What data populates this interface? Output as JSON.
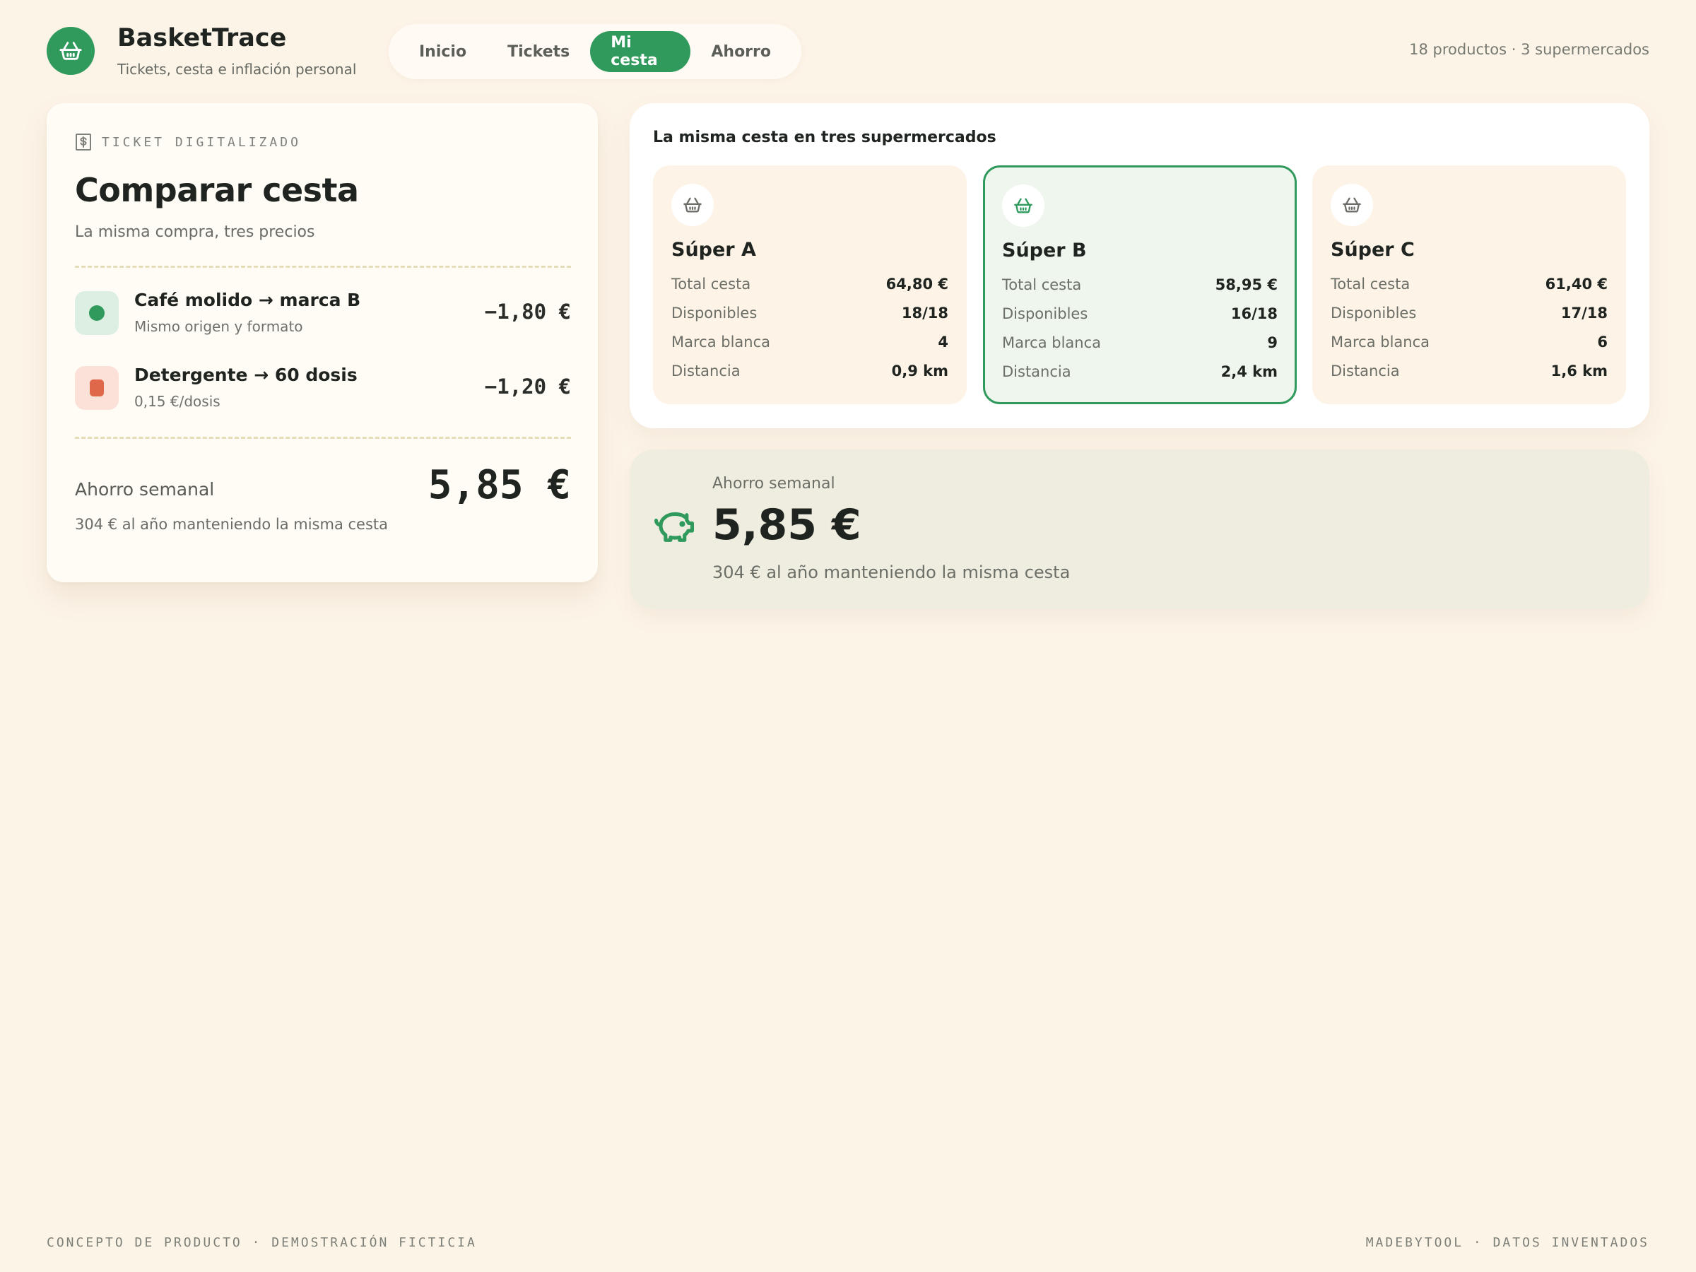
{
  "app": {
    "name": "BasketTrace",
    "tagline": "Tickets, cesta e inflación personal",
    "meta": "18 productos · 3 supermercados"
  },
  "nav": {
    "items": [
      {
        "label": "Inicio",
        "active": false
      },
      {
        "label": "Tickets",
        "active": false
      },
      {
        "label": "Mi cesta",
        "active": true
      },
      {
        "label": "Ahorro",
        "active": false
      }
    ]
  },
  "ticket": {
    "kicker": "TICKET DIGITALIZADO",
    "title": "Comparar cesta",
    "subtitle": "La misma compra, tres precios",
    "swaps": [
      {
        "name": "Café molido → marca B",
        "note": "Mismo origen y formato",
        "amount": "−1,80 €",
        "color": "green"
      },
      {
        "name": "Detergente → 60 dosis",
        "note": "0,15 €/dosis",
        "amount": "−1,20 €",
        "color": "red"
      }
    ],
    "saving_label": "Ahorro semanal",
    "saving_value": "5,85 €",
    "yearly": "304 € al año manteniendo la misma cesta"
  },
  "compare": {
    "title": "La misma cesta en tres supermercados",
    "stores": [
      {
        "name": "Súper A",
        "best": false,
        "rows": [
          {
            "label": "Total cesta",
            "value": "64,80 €"
          },
          {
            "label": "Disponibles",
            "value": "18/18"
          },
          {
            "label": "Marca blanca",
            "value": "4"
          },
          {
            "label": "Distancia",
            "value": "0,9 km"
          }
        ]
      },
      {
        "name": "Súper B",
        "best": true,
        "rows": [
          {
            "label": "Total cesta",
            "value": "58,95 €"
          },
          {
            "label": "Disponibles",
            "value": "16/18"
          },
          {
            "label": "Marca blanca",
            "value": "9"
          },
          {
            "label": "Distancia",
            "value": "2,4 km"
          }
        ]
      },
      {
        "name": "Súper C",
        "best": false,
        "rows": [
          {
            "label": "Total cesta",
            "value": "61,40 €"
          },
          {
            "label": "Disponibles",
            "value": "17/18"
          },
          {
            "label": "Marca blanca",
            "value": "6"
          },
          {
            "label": "Distancia",
            "value": "1,6 km"
          }
        ]
      }
    ]
  },
  "saving": {
    "label": "Ahorro semanal",
    "value": "5,85 €",
    "yearly": "304 € al año manteniendo la misma cesta"
  },
  "footer": {
    "left": "CONCEPTO DE PRODUCTO · DEMOSTRACIÓN FICTICIA",
    "right": "MADEBYTOOL · DATOS INVENTADOS"
  },
  "icons": {
    "logo": "basket-icon",
    "ticket": "dollar-receipt-icon",
    "store": "basket-icon",
    "saving": "piggy-bank-icon"
  },
  "colors": {
    "accent": "#2f9a5c",
    "background": "#fdf4e8",
    "danger": "#e0684a"
  }
}
